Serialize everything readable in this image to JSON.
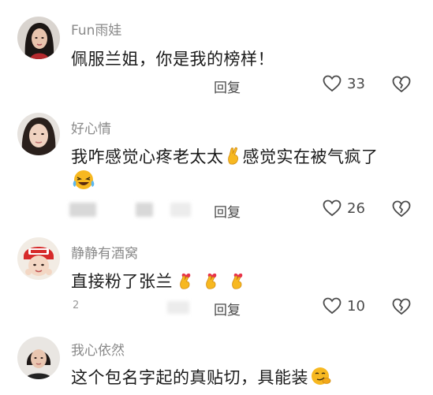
{
  "comments": [
    {
      "username": "Fun雨娃",
      "text": "佩服兰姐，你是我的榜样！",
      "reply_label": "回复",
      "likes": "33",
      "avatar_icon": "woman-portrait-avatar"
    },
    {
      "username": "好心情",
      "text_part1": "我咋感觉心疼老太太",
      "text_part2": "感觉实在被气疯了",
      "reply_label": "回复",
      "likes": "26",
      "avatar_icon": "woman-portrait-avatar",
      "emojis": [
        "crossed-fingers-emoji",
        "laughing-tears-emoji"
      ]
    },
    {
      "username": "静静有酒窝",
      "text": "直接粉了张兰",
      "reply_label": "回复",
      "likes": "10",
      "time_fragment": "2",
      "avatar_icon": "cartoon-child-avatar",
      "emojis": [
        "heart-fingers-emoji",
        "heart-fingers-emoji",
        "heart-fingers-emoji"
      ]
    },
    {
      "username": "我心依然",
      "text": "这个包名字起的真贴切，具能装",
      "avatar_icon": "woman-portrait-avatar",
      "emojis": [
        "smirk-face-emoji"
      ]
    }
  ],
  "colors": {
    "username": "#8a8a8a",
    "text": "#1a1a1a",
    "meta": "#4a4a4a",
    "emoji_yellow": "#f7b820",
    "heart_red": "#e8334a"
  }
}
